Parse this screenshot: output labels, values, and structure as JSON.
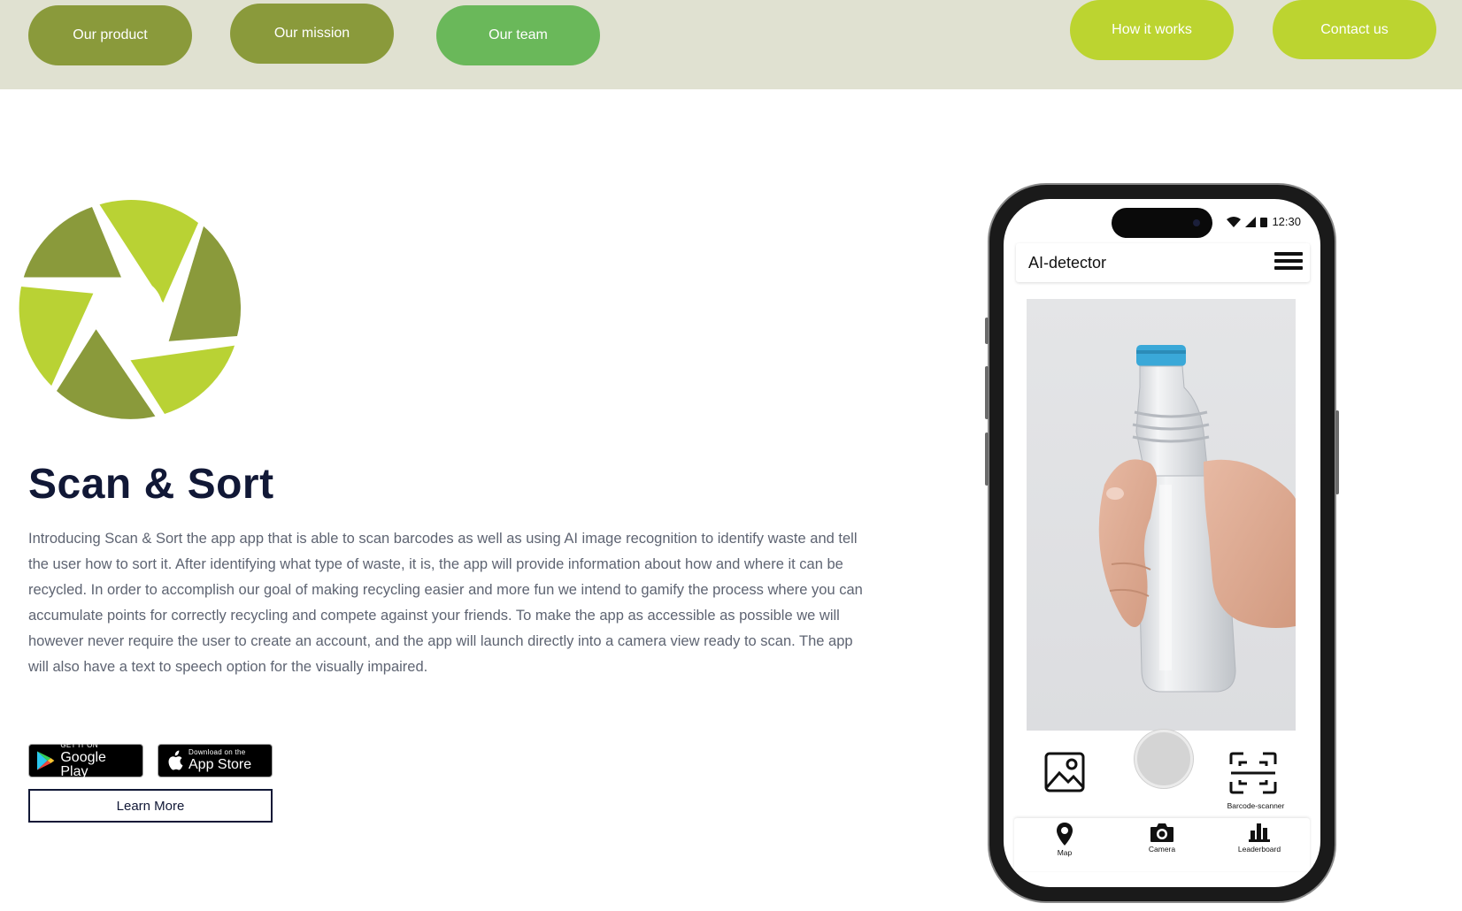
{
  "nav": {
    "product": "Our product",
    "mission": "Our mission",
    "team": "Our team",
    "how": "How it works",
    "contact": "Contact us"
  },
  "hero": {
    "title": "Scan & Sort",
    "description": "Introducing Scan & Sort the app app that is able to scan barcodes as well as using AI image recognition to identify waste and tell the user how to sort it. After identifying what type of waste, it is, the app will provide information about how and where it can be recycled. In order to accomplish our goal of making recycling easier and more fun we intend to gamify the process where you can accumulate points for correctly recycling and compete against your friends. To make the app as accessible as possible we will however never require the user to create an account, and the app will launch directly into a camera view ready to scan. The app will also have a text to speech option for the visually impaired."
  },
  "stores": {
    "google_small": "GET IT ON",
    "google_big": "Google Play",
    "apple_small": "Download on the",
    "apple_big": "App Store"
  },
  "learn_more": "Learn More",
  "phone": {
    "time": "12:30",
    "app_title": "AI-detector",
    "barcode_label": "Barcode-scanner",
    "nav": {
      "map": "Map",
      "camera": "Camera",
      "leaderboard": "Leaderboard"
    }
  },
  "colors": {
    "olive": "#8a9a3b",
    "green": "#6ab85a",
    "lime": "#bcd430",
    "navy": "#111836",
    "topbar": "#e0e1d1"
  }
}
